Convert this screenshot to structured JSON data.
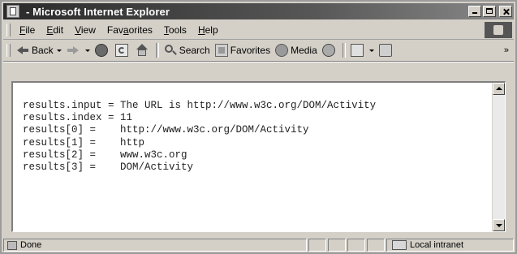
{
  "window": {
    "title": "- Microsoft Internet Explorer"
  },
  "menu": {
    "items": [
      {
        "label": "File",
        "accel": "F"
      },
      {
        "label": "Edit",
        "accel": "E"
      },
      {
        "label": "View",
        "accel": "V"
      },
      {
        "label": "Favorites",
        "accel": "a"
      },
      {
        "label": "Tools",
        "accel": "T"
      },
      {
        "label": "Help",
        "accel": "H"
      }
    ]
  },
  "toolbar": {
    "back_label": "Back",
    "search_label": "Search",
    "favorites_label": "Favorites",
    "media_label": "Media",
    "overflow": "»"
  },
  "content": {
    "lines": [
      "results.input = The URL is http://www.w3c.org/DOM/Activity",
      "results.index = 11",
      "results[0] =    http://www.w3c.org/DOM/Activity",
      "results[1] =    http",
      "results[2] =    www.w3c.org",
      "results[3] =    DOM/Activity"
    ]
  },
  "status": {
    "text": "Done",
    "zone": "Local intranet"
  }
}
